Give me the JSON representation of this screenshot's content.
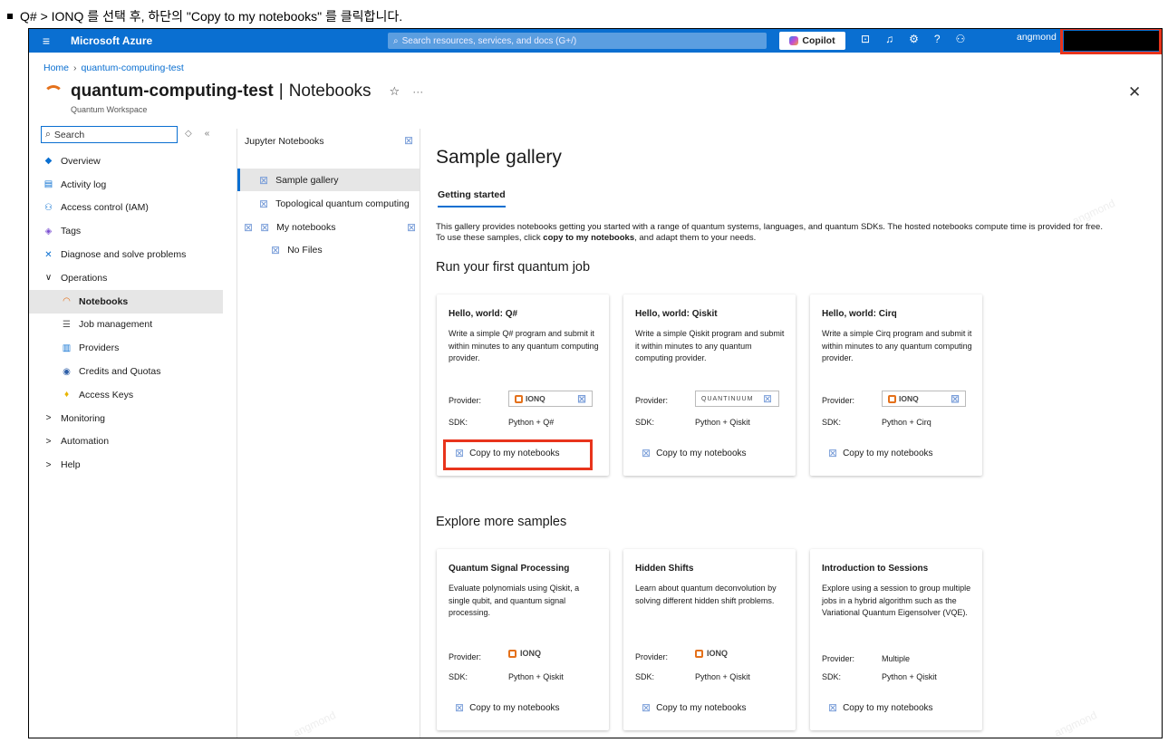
{
  "instruction": "Q# > IONQ 를 선택 후, 하단의 \"Copy to my notebooks\" 를 클릭합니다.",
  "topbar": {
    "menu_icon": "≡",
    "brand": "Microsoft Azure",
    "search_placeholder": "Search resources, services, and docs (G+/)",
    "copilot_label": "Copilot",
    "icons": [
      "cloud-shell-icon",
      "bell-icon",
      "gear-icon",
      "help-icon",
      "feedback-icon"
    ],
    "user": "angmond"
  },
  "breadcrumb": [
    "Home",
    "quantum-computing-test"
  ],
  "header": {
    "resource": "quantum-computing-test",
    "section": "Notebooks",
    "type": "Quantum Workspace",
    "star": "☆",
    "more": "···",
    "close": "✕"
  },
  "nav": {
    "search_placeholder": "Search",
    "items": [
      {
        "label": "Overview",
        "icon": "◆"
      },
      {
        "label": "Activity log",
        "icon": "▤"
      },
      {
        "label": "Access control (IAM)",
        "icon": "⚇"
      },
      {
        "label": "Tags",
        "icon": "◈"
      },
      {
        "label": "Diagnose and solve problems",
        "icon": "✕"
      },
      {
        "label": "Operations",
        "icon": "∨"
      },
      {
        "label": "Notebooks",
        "icon": "◠"
      },
      {
        "label": "Job management",
        "icon": "☰"
      },
      {
        "label": "Providers",
        "icon": "▥"
      },
      {
        "label": "Credits and Quotas",
        "icon": "◉"
      },
      {
        "label": "Access Keys",
        "icon": "♦"
      },
      {
        "label": "Monitoring",
        "icon": ">"
      },
      {
        "label": "Automation",
        "icon": ">"
      },
      {
        "label": "Help",
        "icon": ">"
      }
    ]
  },
  "tree": {
    "header": "Jupyter Notebooks",
    "items": [
      "Sample gallery",
      "Topological quantum computing",
      "My notebooks",
      "No Files"
    ]
  },
  "main": {
    "title": "Sample gallery",
    "tab": "Getting started",
    "intro_pre": "This gallery provides notebooks getting you started with a range of quantum systems, languages, and quantum SDKs. The hosted notebooks compute time is provided for free. To use these samples, click ",
    "intro_bold": "copy to my notebooks",
    "intro_post": ", and adapt them to your needs.",
    "section1": "Run your first quantum job",
    "section2": "Explore more samples",
    "provider_label": "Provider:",
    "sdk_label": "SDK:",
    "copy_label": "Copy to my notebooks",
    "cards": [
      {
        "title": "Hello, world: Q#",
        "desc": "Write a simple Q# program and submit it within minutes to any quantum computing provider.",
        "provider": "IONQ",
        "sdk": "Python + Q#"
      },
      {
        "title": "Hello, world: Qiskit",
        "desc": "Write a simple Qiskit program and submit it within minutes to any quantum computing provider.",
        "provider": "QUANTINUUM",
        "sdk": "Python + Qiskit"
      },
      {
        "title": "Hello, world: Cirq",
        "desc": "Write a simple Cirq program and submit it within minutes to any quantum computing provider.",
        "provider": "IONQ",
        "sdk": "Python + Cirq"
      },
      {
        "title": "Quantum Signal Processing",
        "desc": "Evaluate polynomials using Qiskit, a single qubit, and quantum signal processing.",
        "provider": "IONQ",
        "sdk": "Python + Qiskit"
      },
      {
        "title": "Hidden Shifts",
        "desc": "Learn about quantum deconvolution by solving different hidden shift problems.",
        "provider": "IONQ",
        "sdk": "Python + Qiskit"
      },
      {
        "title": "Introduction to Sessions",
        "desc": "Explore using a session to group multiple jobs in a hybrid algorithm such as the Variational Quantum Eigensolver (VQE).",
        "provider": "Multiple",
        "sdk": "Python + Qiskit"
      }
    ]
  },
  "watermark": "angmond"
}
